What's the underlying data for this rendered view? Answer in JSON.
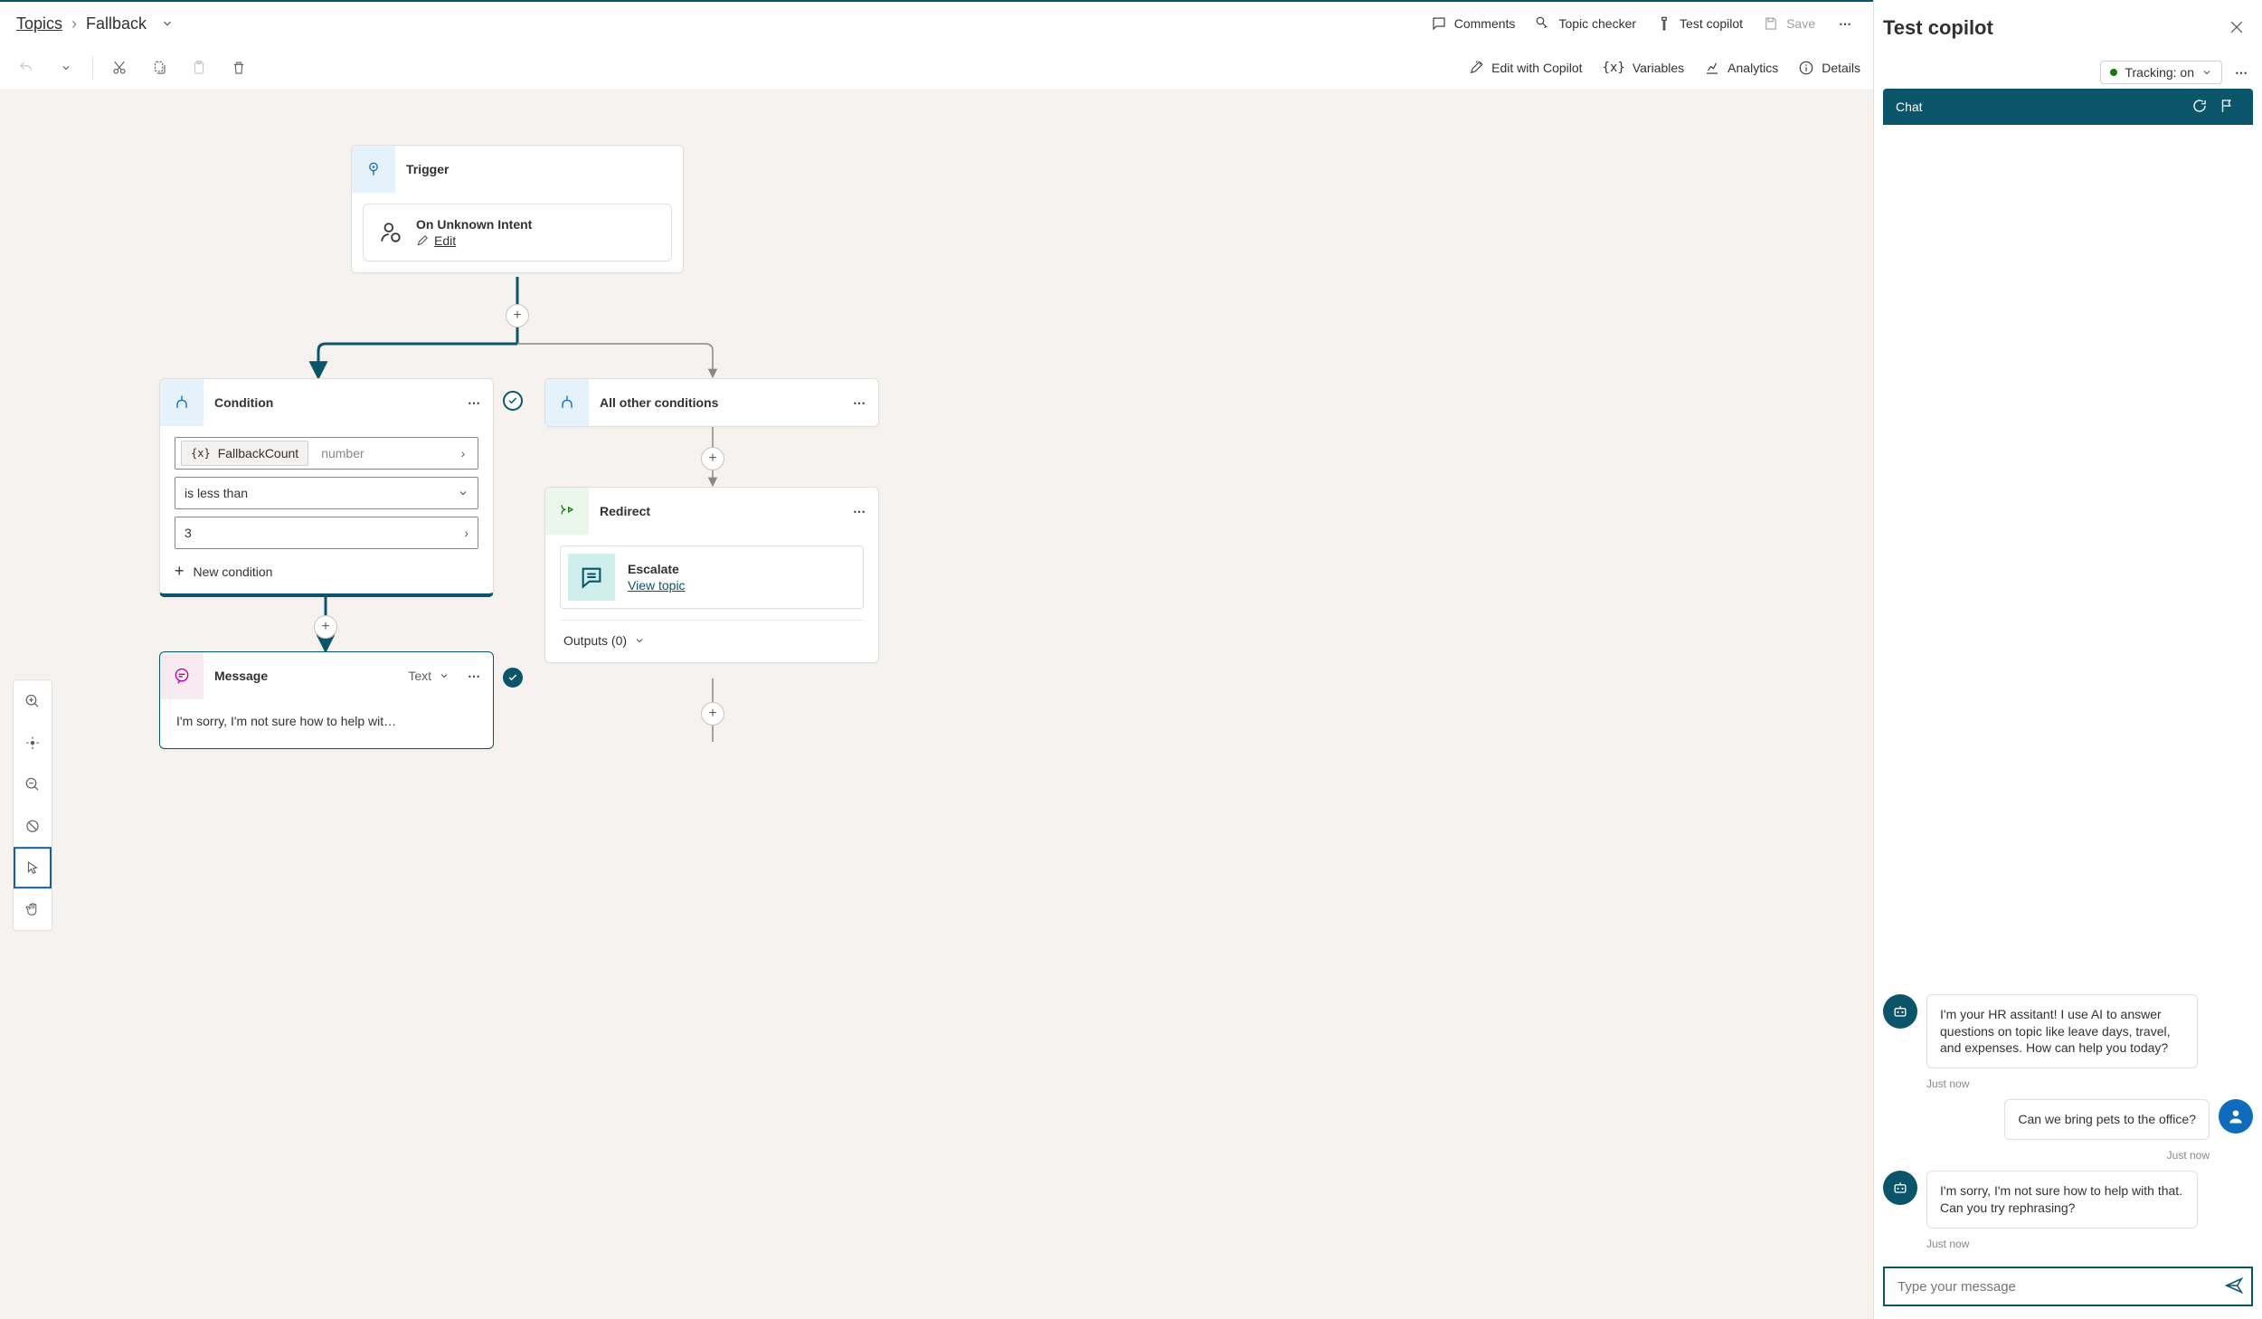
{
  "breadcrumb": {
    "root": "Topics",
    "current": "Fallback"
  },
  "top_actions": {
    "comments": "Comments",
    "checker": "Topic checker",
    "test": "Test copilot",
    "save": "Save"
  },
  "toolbar": {
    "edit_copilot": "Edit with Copilot",
    "variables": "Variables",
    "analytics": "Analytics",
    "details": "Details"
  },
  "nodes": {
    "trigger": {
      "title": "Trigger",
      "event": "On Unknown Intent",
      "edit": "Edit"
    },
    "condition": {
      "title": "Condition",
      "variable": "FallbackCount",
      "var_type": "number",
      "operator": "is less than",
      "value": "3",
      "new_condition": "New condition"
    },
    "other": {
      "title": "All other conditions"
    },
    "redirect": {
      "title": "Redirect",
      "target": "Escalate",
      "link": "View topic",
      "outputs": "Outputs (0)"
    },
    "message": {
      "title": "Message",
      "type": "Text",
      "body": "I'm sorry, I'm not sure how to help wit…"
    }
  },
  "test_panel": {
    "title": "Test copilot",
    "tracking": "Tracking: on",
    "chat_label": "Chat",
    "messages": {
      "bot1": "I'm your HR assitant! I use AI to answer questions on topic like leave days, travel, and expenses. How can help you today?",
      "bot1_time": "Just now",
      "user1": "Can we bring pets to the office?",
      "user1_time": "Just now",
      "bot2": "I'm sorry, I'm not sure how to help with that. Can you try rephrasing?",
      "bot2_time": "Just now"
    },
    "input_placeholder": "Type your message"
  }
}
